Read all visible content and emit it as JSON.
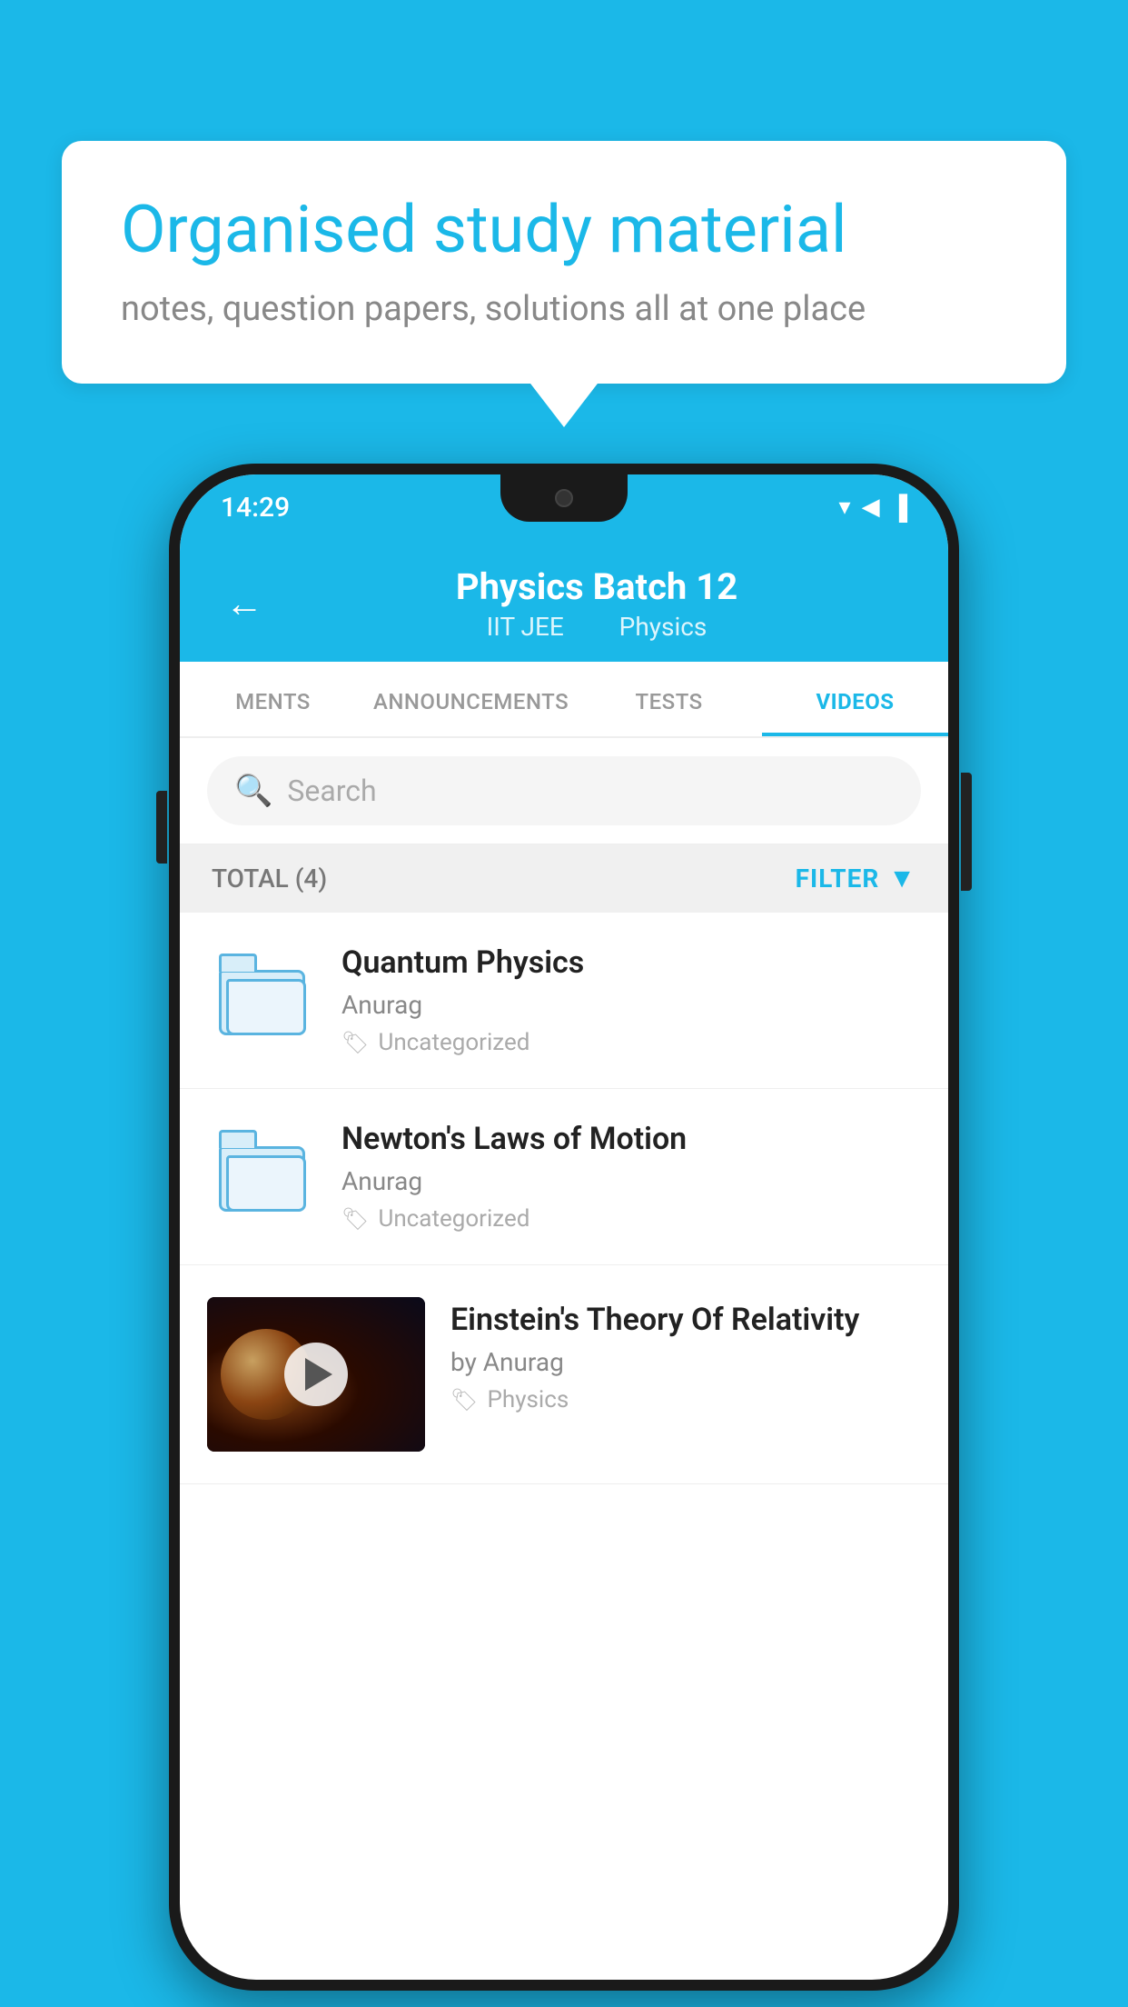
{
  "background_color": "#1bb8e8",
  "speech_bubble": {
    "title": "Organised study material",
    "subtitle": "notes, question papers, solutions all at one place"
  },
  "phone": {
    "status_bar": {
      "time": "14:29",
      "icons": "▼◀▐"
    },
    "header": {
      "back_label": "←",
      "title": "Physics Batch 12",
      "subtitle_1": "IIT JEE",
      "subtitle_2": "Physics"
    },
    "tabs": [
      {
        "label": "MENTS",
        "active": false
      },
      {
        "label": "ANNOUNCEMENTS",
        "active": false
      },
      {
        "label": "TESTS",
        "active": false
      },
      {
        "label": "VIDEOS",
        "active": true
      }
    ],
    "search": {
      "placeholder": "Search"
    },
    "filter_row": {
      "total": "TOTAL (4)",
      "filter_label": "FILTER"
    },
    "videos": [
      {
        "id": 1,
        "title": "Quantum Physics",
        "author": "Anurag",
        "tag": "Uncategorized",
        "has_thumbnail": false
      },
      {
        "id": 2,
        "title": "Newton's Laws of Motion",
        "author": "Anurag",
        "tag": "Uncategorized",
        "has_thumbnail": false
      },
      {
        "id": 3,
        "title": "Einstein's Theory Of Relativity",
        "author": "by Anurag",
        "tag": "Physics",
        "has_thumbnail": true
      }
    ]
  }
}
